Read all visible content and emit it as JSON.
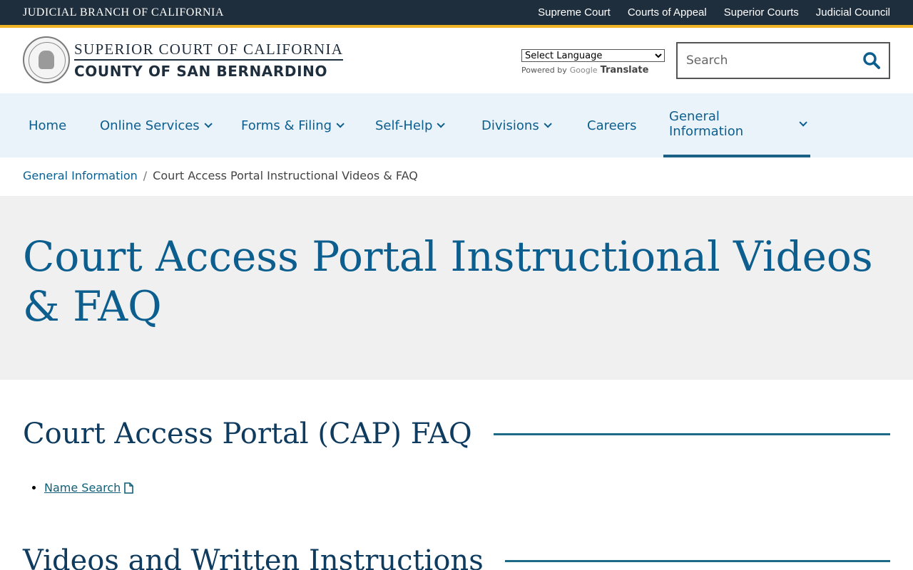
{
  "topbar": {
    "brand": "JUDICIAL BRANCH OF CALIFORNIA",
    "links": [
      "Supreme Court",
      "Courts of Appeal",
      "Superior Courts",
      "Judicial Council"
    ]
  },
  "header": {
    "logo_line1": "SUPERIOR COURT OF CALIFORNIA",
    "logo_line2": "COUNTY OF SAN BERNARDINO",
    "language_select": "Select Language",
    "powered_by": "Powered by",
    "google": "Google",
    "translate": "Translate",
    "search_placeholder": "Search"
  },
  "nav": {
    "items": [
      {
        "label": "Home",
        "has_dropdown": false
      },
      {
        "label": "Online Services",
        "has_dropdown": true
      },
      {
        "label": "Forms & Filing",
        "has_dropdown": true
      },
      {
        "label": "Self-Help",
        "has_dropdown": true
      },
      {
        "label": "Divisions",
        "has_dropdown": true
      },
      {
        "label": "Careers",
        "has_dropdown": false
      },
      {
        "label": "General Information",
        "has_dropdown": true,
        "active": true
      }
    ]
  },
  "breadcrumb": {
    "parent": "General Information",
    "separator": "/",
    "current": "Court Access Portal Instructional Videos & FAQ"
  },
  "hero": {
    "title": "Court Access Portal Instructional Videos & FAQ"
  },
  "content": {
    "section1_title": "Court Access Portal (CAP) FAQ",
    "section1_links": [
      "Name Search"
    ],
    "section2_title": "Videos and Written Instructions"
  },
  "colors": {
    "topbar_bg": "#1f2e3d",
    "accent_gold": "#f0b323",
    "link_blue": "#0b5e8e",
    "nav_bg": "#ebf3fa",
    "hero_bg": "#f0f0f0"
  }
}
